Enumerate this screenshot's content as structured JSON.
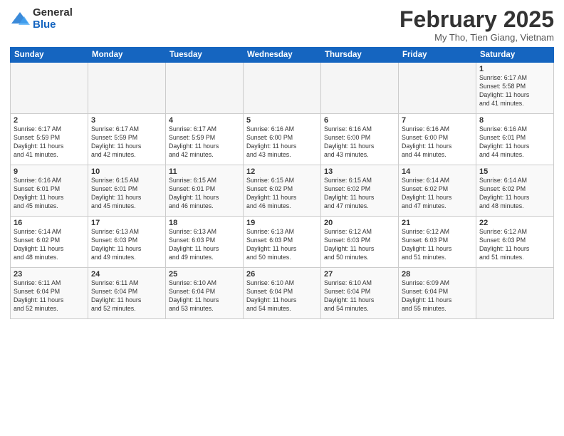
{
  "logo": {
    "general": "General",
    "blue": "Blue"
  },
  "title": "February 2025",
  "subtitle": "My Tho, Tien Giang, Vietnam",
  "days_of_week": [
    "Sunday",
    "Monday",
    "Tuesday",
    "Wednesday",
    "Thursday",
    "Friday",
    "Saturday"
  ],
  "weeks": [
    [
      {
        "day": "",
        "info": ""
      },
      {
        "day": "",
        "info": ""
      },
      {
        "day": "",
        "info": ""
      },
      {
        "day": "",
        "info": ""
      },
      {
        "day": "",
        "info": ""
      },
      {
        "day": "",
        "info": ""
      },
      {
        "day": "1",
        "info": "Sunrise: 6:17 AM\nSunset: 5:58 PM\nDaylight: 11 hours\nand 41 minutes."
      }
    ],
    [
      {
        "day": "2",
        "info": "Sunrise: 6:17 AM\nSunset: 5:59 PM\nDaylight: 11 hours\nand 41 minutes."
      },
      {
        "day": "3",
        "info": "Sunrise: 6:17 AM\nSunset: 5:59 PM\nDaylight: 11 hours\nand 42 minutes."
      },
      {
        "day": "4",
        "info": "Sunrise: 6:17 AM\nSunset: 5:59 PM\nDaylight: 11 hours\nand 42 minutes."
      },
      {
        "day": "5",
        "info": "Sunrise: 6:16 AM\nSunset: 6:00 PM\nDaylight: 11 hours\nand 43 minutes."
      },
      {
        "day": "6",
        "info": "Sunrise: 6:16 AM\nSunset: 6:00 PM\nDaylight: 11 hours\nand 43 minutes."
      },
      {
        "day": "7",
        "info": "Sunrise: 6:16 AM\nSunset: 6:00 PM\nDaylight: 11 hours\nand 44 minutes."
      },
      {
        "day": "8",
        "info": "Sunrise: 6:16 AM\nSunset: 6:01 PM\nDaylight: 11 hours\nand 44 minutes."
      }
    ],
    [
      {
        "day": "9",
        "info": "Sunrise: 6:16 AM\nSunset: 6:01 PM\nDaylight: 11 hours\nand 45 minutes."
      },
      {
        "day": "10",
        "info": "Sunrise: 6:15 AM\nSunset: 6:01 PM\nDaylight: 11 hours\nand 45 minutes."
      },
      {
        "day": "11",
        "info": "Sunrise: 6:15 AM\nSunset: 6:01 PM\nDaylight: 11 hours\nand 46 minutes."
      },
      {
        "day": "12",
        "info": "Sunrise: 6:15 AM\nSunset: 6:02 PM\nDaylight: 11 hours\nand 46 minutes."
      },
      {
        "day": "13",
        "info": "Sunrise: 6:15 AM\nSunset: 6:02 PM\nDaylight: 11 hours\nand 47 minutes."
      },
      {
        "day": "14",
        "info": "Sunrise: 6:14 AM\nSunset: 6:02 PM\nDaylight: 11 hours\nand 47 minutes."
      },
      {
        "day": "15",
        "info": "Sunrise: 6:14 AM\nSunset: 6:02 PM\nDaylight: 11 hours\nand 48 minutes."
      }
    ],
    [
      {
        "day": "16",
        "info": "Sunrise: 6:14 AM\nSunset: 6:02 PM\nDaylight: 11 hours\nand 48 minutes."
      },
      {
        "day": "17",
        "info": "Sunrise: 6:13 AM\nSunset: 6:03 PM\nDaylight: 11 hours\nand 49 minutes."
      },
      {
        "day": "18",
        "info": "Sunrise: 6:13 AM\nSunset: 6:03 PM\nDaylight: 11 hours\nand 49 minutes."
      },
      {
        "day": "19",
        "info": "Sunrise: 6:13 AM\nSunset: 6:03 PM\nDaylight: 11 hours\nand 50 minutes."
      },
      {
        "day": "20",
        "info": "Sunrise: 6:12 AM\nSunset: 6:03 PM\nDaylight: 11 hours\nand 50 minutes."
      },
      {
        "day": "21",
        "info": "Sunrise: 6:12 AM\nSunset: 6:03 PM\nDaylight: 11 hours\nand 51 minutes."
      },
      {
        "day": "22",
        "info": "Sunrise: 6:12 AM\nSunset: 6:03 PM\nDaylight: 11 hours\nand 51 minutes."
      }
    ],
    [
      {
        "day": "23",
        "info": "Sunrise: 6:11 AM\nSunset: 6:04 PM\nDaylight: 11 hours\nand 52 minutes."
      },
      {
        "day": "24",
        "info": "Sunrise: 6:11 AM\nSunset: 6:04 PM\nDaylight: 11 hours\nand 52 minutes."
      },
      {
        "day": "25",
        "info": "Sunrise: 6:10 AM\nSunset: 6:04 PM\nDaylight: 11 hours\nand 53 minutes."
      },
      {
        "day": "26",
        "info": "Sunrise: 6:10 AM\nSunset: 6:04 PM\nDaylight: 11 hours\nand 54 minutes."
      },
      {
        "day": "27",
        "info": "Sunrise: 6:10 AM\nSunset: 6:04 PM\nDaylight: 11 hours\nand 54 minutes."
      },
      {
        "day": "28",
        "info": "Sunrise: 6:09 AM\nSunset: 6:04 PM\nDaylight: 11 hours\nand 55 minutes."
      },
      {
        "day": "",
        "info": ""
      }
    ]
  ]
}
